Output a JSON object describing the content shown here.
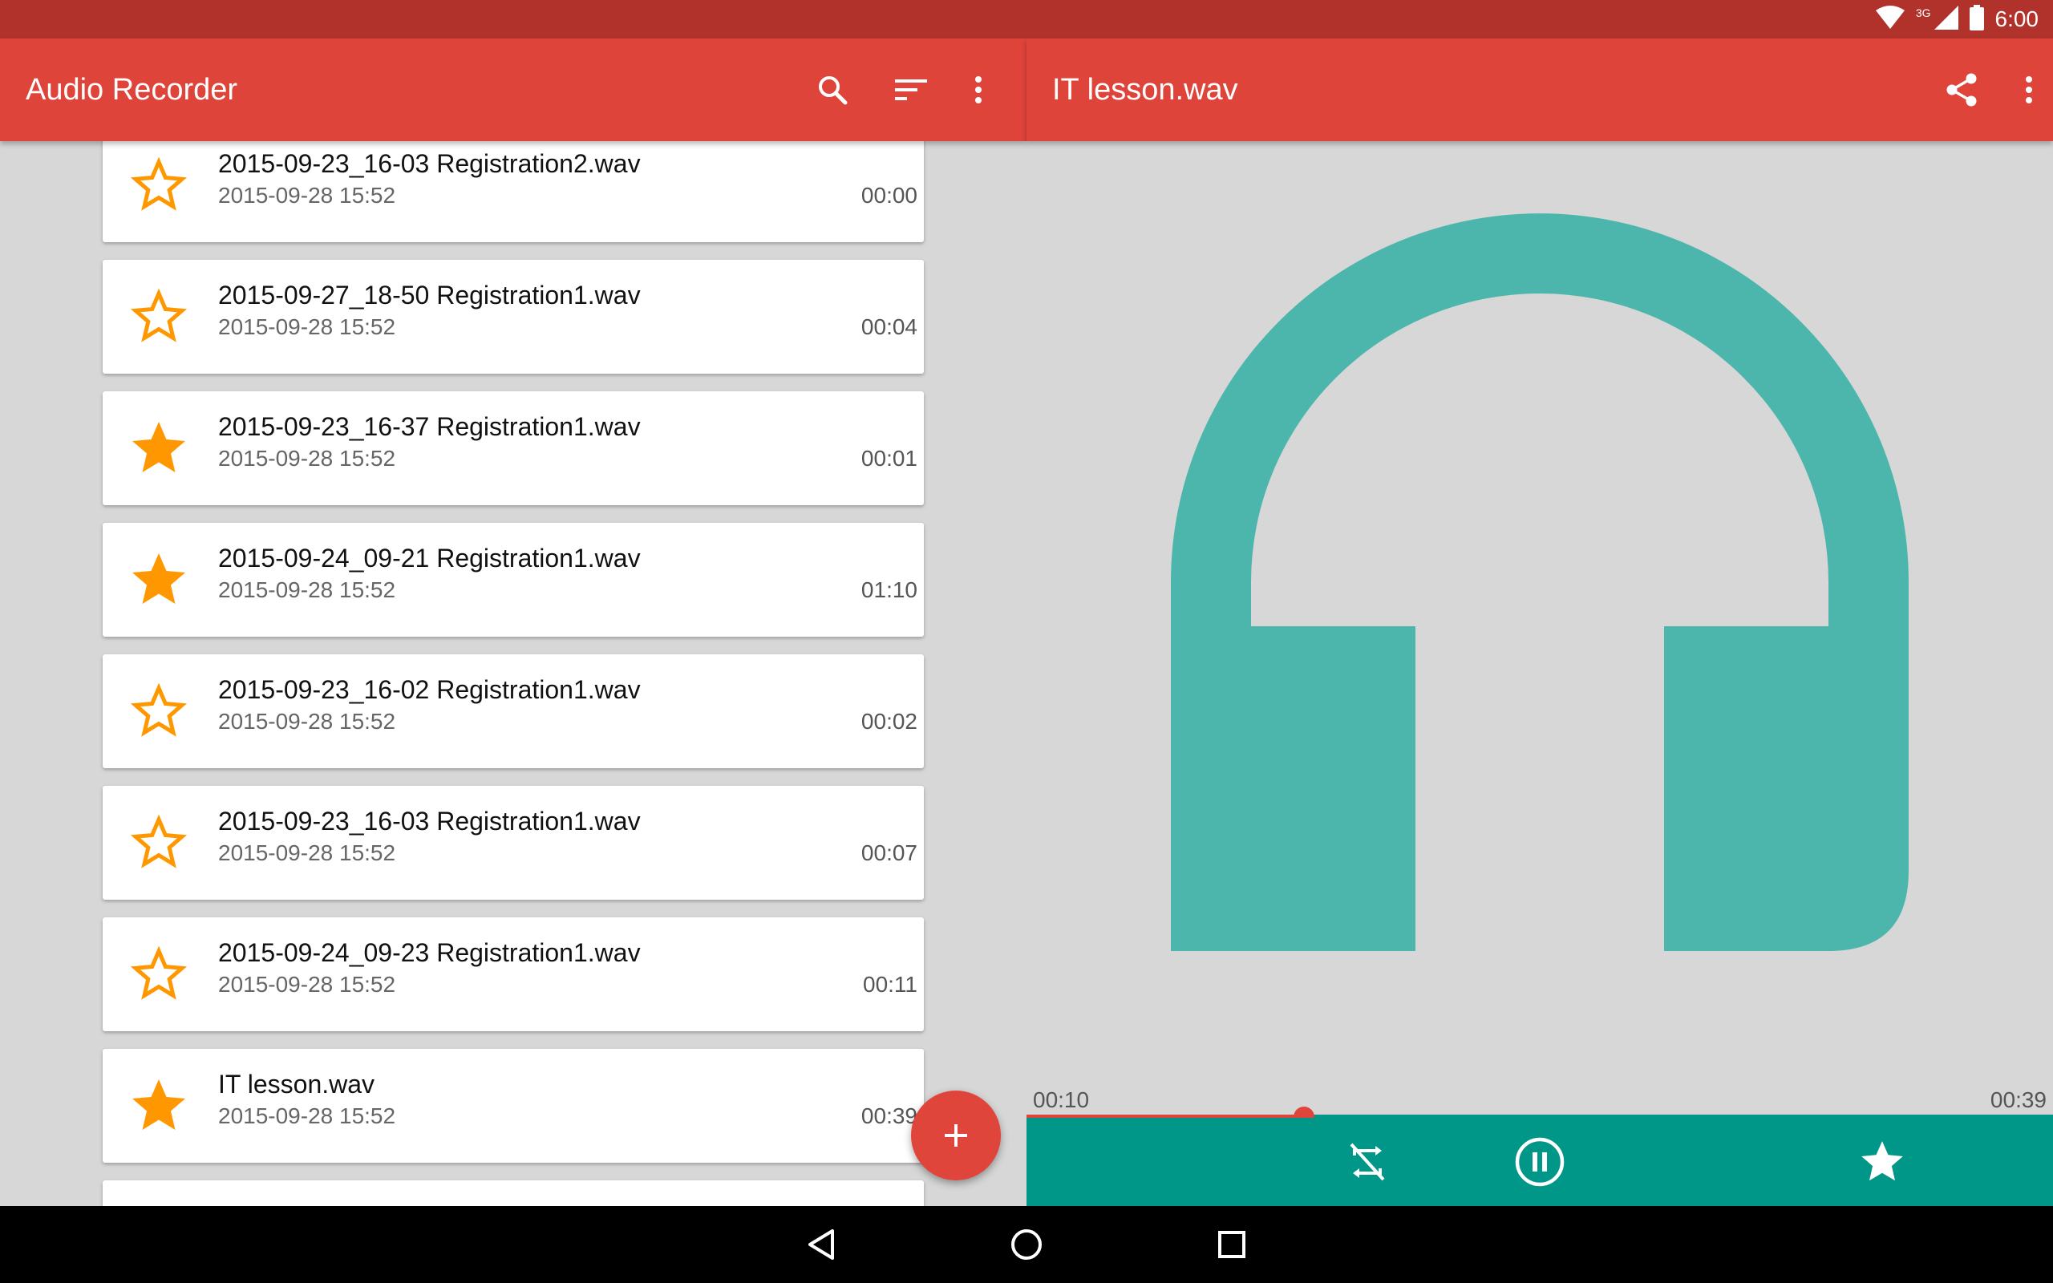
{
  "status_bar": {
    "network_label": "3G",
    "time": "6:00"
  },
  "app_bar": {
    "title": "Audio Recorder"
  },
  "recordings": [
    {
      "name": "2015-09-23_16-03 Registration2.wav",
      "date": "2015-09-28 15:52",
      "duration": "00:00",
      "starred": false
    },
    {
      "name": "2015-09-27_18-50 Registration1.wav",
      "date": "2015-09-28 15:52",
      "duration": "00:04",
      "starred": false
    },
    {
      "name": "2015-09-23_16-37 Registration1.wav",
      "date": "2015-09-28 15:52",
      "duration": "00:01",
      "starred": true
    },
    {
      "name": "2015-09-24_09-21 Registration1.wav",
      "date": "2015-09-28 15:52",
      "duration": "01:10",
      "starred": true
    },
    {
      "name": "2015-09-23_16-02 Registration1.wav",
      "date": "2015-09-28 15:52",
      "duration": "00:02",
      "starred": false
    },
    {
      "name": "2015-09-23_16-03 Registration1.wav",
      "date": "2015-09-28 15:52",
      "duration": "00:07",
      "starred": false
    },
    {
      "name": "2015-09-24_09-23 Registration1.wav",
      "date": "2015-09-28 15:52",
      "duration": "00:11",
      "starred": false
    },
    {
      "name": "IT lesson.wav",
      "date": "2015-09-28 15:52",
      "duration": "00:39",
      "starred": true
    },
    {
      "name": "",
      "date": "",
      "duration": "",
      "starred": true
    }
  ],
  "player": {
    "title": "IT lesson.wav",
    "elapsed": "00:10",
    "total": "00:39",
    "progress_fraction": 0.27,
    "art_icon": "headphones-icon"
  },
  "colors": {
    "primary": "#de443a",
    "status_bar": "#b1322b",
    "accent_teal": "#009688",
    "art_teal": "#4db6ac",
    "star_orange": "#ff9800",
    "fab": "#e0453b"
  }
}
